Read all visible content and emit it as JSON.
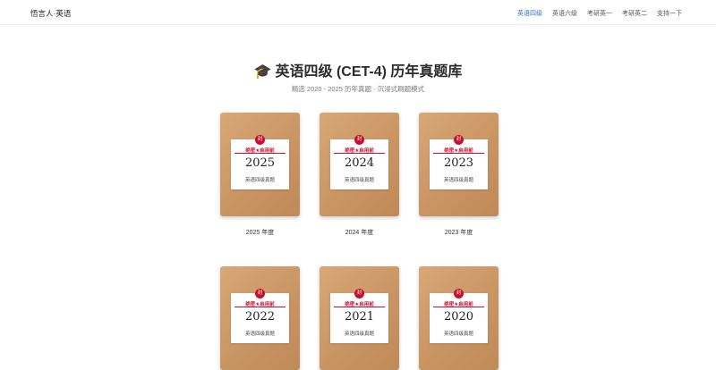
{
  "nav": {
    "brand": "悟言人·英语",
    "links": [
      "英语四级",
      "英语六级",
      "考研英一",
      "考研英二",
      "支持一下"
    ]
  },
  "hero": {
    "title": "英语四级 (CET-4) 历年真题库",
    "subtitle": "精选 2020 - 2025 历年真题 · 沉浸式刷题模式"
  },
  "cards": [
    {
      "year": "2025",
      "caption": "2025 年度",
      "secret": "绝密★启用前",
      "desc": "英语四级真题",
      "seal": "封"
    },
    {
      "year": "2024",
      "caption": "2024 年度",
      "secret": "绝密★启用前",
      "desc": "英语四级真题",
      "seal": "封"
    },
    {
      "year": "2023",
      "caption": "2023 年度",
      "secret": "绝密★启用前",
      "desc": "英语四级真题",
      "seal": "封"
    },
    {
      "year": "2022",
      "caption": "",
      "secret": "绝密★启用前",
      "desc": "英语四级真题",
      "seal": "封"
    },
    {
      "year": "2021",
      "caption": "",
      "secret": "绝密★启用前",
      "desc": "英语四级真题",
      "seal": "封"
    },
    {
      "year": "2020",
      "caption": "",
      "secret": "绝密★启用前",
      "desc": "英语四级真题",
      "seal": "封"
    }
  ],
  "colors": {
    "accent": "#3b6ccc",
    "seal": "#c8102e",
    "envelope": "#c99563"
  }
}
